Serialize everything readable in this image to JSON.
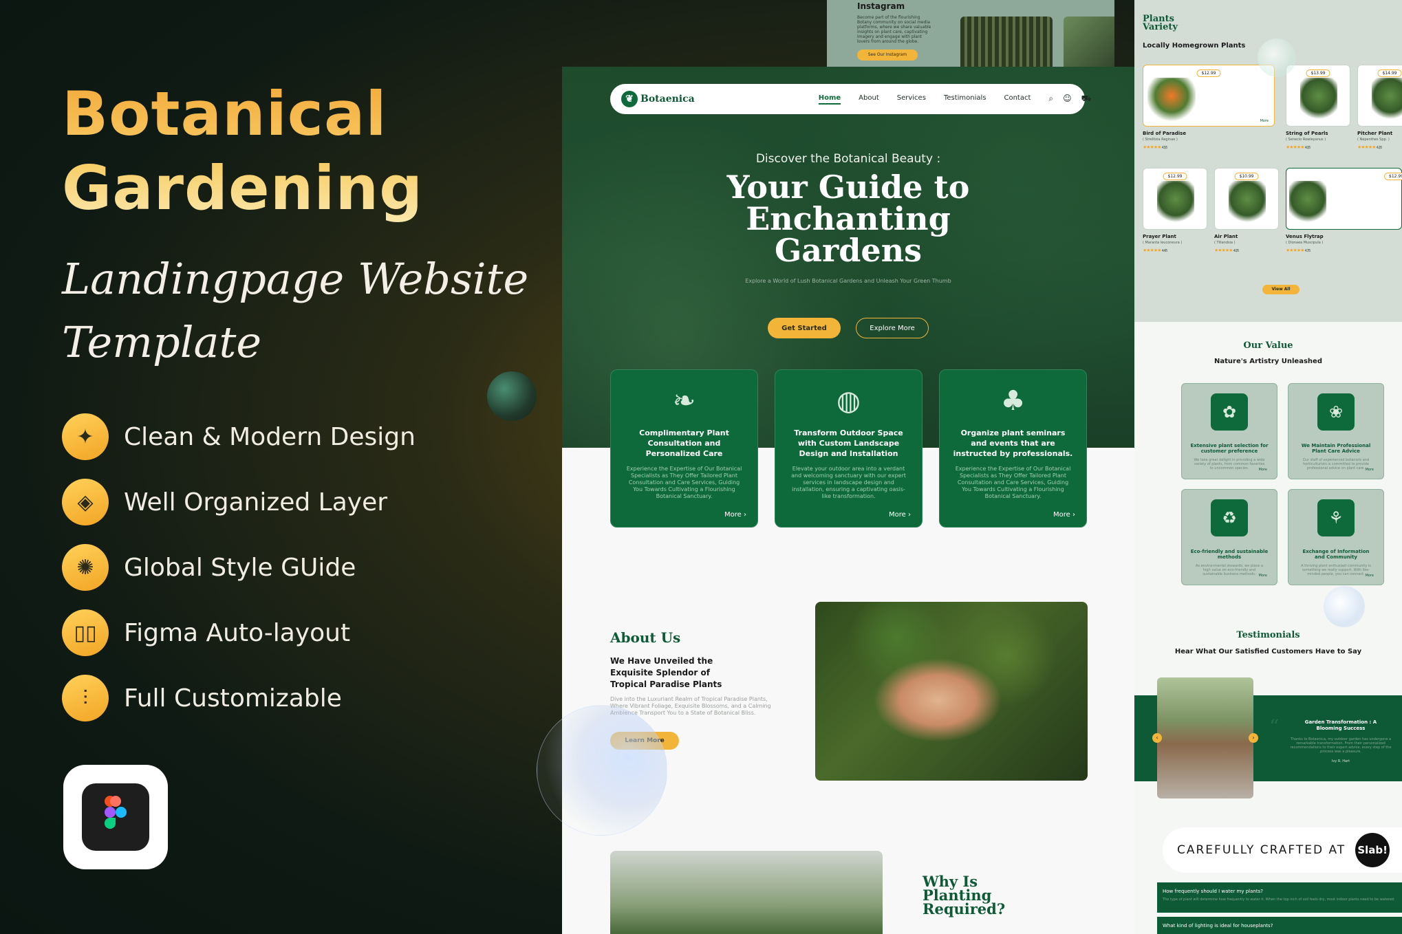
{
  "left": {
    "title_line1": "Botanical",
    "title_line2": "Gardening",
    "subtitle_line1": "Landingpage Website",
    "subtitle_line2": "Template",
    "features": [
      {
        "icon": "magic-wand-icon",
        "glyph": "✦",
        "label": "Clean & Modern Design"
      },
      {
        "icon": "layers-icon",
        "glyph": "◈",
        "label": "Well Organized Layer"
      },
      {
        "icon": "palette-icon",
        "glyph": "✺",
        "label": "Global Style GUide"
      },
      {
        "icon": "columns-icon",
        "glyph": "▯▯",
        "label": "Figma Auto-layout"
      },
      {
        "icon": "sliders-icon",
        "glyph": "⫶",
        "label": "Full Customizable"
      }
    ],
    "badge_icon": "figma-logo-icon"
  },
  "instagram": {
    "title": "Instagram",
    "body": "Become part of the flourishing Botany community on social media platforms, where we share valuable insights on plant care, captivating imagery and engage with plant lovers from around the globe.",
    "button": "See Our Instagram"
  },
  "site": {
    "logo": "Botaenica",
    "nav": [
      "Home",
      "About",
      "Services",
      "Testimonials",
      "Contact"
    ],
    "hero_pre": "Discover the Botanical Beauty :",
    "hero_h1_1": "Your Guide to",
    "hero_h1_2": "Enchanting",
    "hero_h1_3": "Gardens",
    "hero_sub": "Explore a World of Lush Botanical Gardens and Unleash Your Green Thumb",
    "btn_primary": "Get Started",
    "btn_secondary": "Explore More",
    "cards": [
      {
        "icon": "plant-consult-icon",
        "title": "Complimentary Plant Consultation and Personalized Care",
        "body": "Experience the Expertise of Our Botanical Specialists as They Offer Tailored Plant Consultation and Care Services, Guiding You Towards Cultivating a Flourishing Botanical Sanctuary.",
        "more": "More"
      },
      {
        "icon": "landscape-globe-icon",
        "title": "Transform Outdoor Space with Custom Landscape Design and Installation",
        "body": "Elevate your outdoor area into a verdant and welcoming sanctuary with our expert services in landscape design and installation, ensuring a captivating oasis-like transformation.",
        "more": "More"
      },
      {
        "icon": "seminar-people-icon",
        "title": "Organize plant seminars and events that are instructed by professionals.",
        "body": "Experience the Expertise of Our Botanical Specialists as They Offer Tailored Plant Consultation and Care Services, Guiding You Towards Cultivating a Flourishing Botanical Sanctuary.",
        "more": "More"
      }
    ],
    "about_h": "About Us",
    "about_h2": "We Have Unveiled the Exquisite Splendor of Tropical Paradise Plants",
    "about_p": "Dive into the Luxuriant Realm of Tropical Paradise Plants, Where Vibrant Foliage, Exquisite Blossoms, and a Calming Ambience Transport You to a State of Botanical Bliss.",
    "learn_more": "Learn More",
    "why_h": "Why Is Planting Required?"
  },
  "right": {
    "plants_h1": "Plants",
    "plants_h2": "Variety",
    "plants_sub": "Locally Homegrown Plants",
    "plants": [
      {
        "name": "Bird of Paradise",
        "sci": "( Strelitzia Reginae )",
        "rating": "4.5/5",
        "price": "$12.99"
      },
      {
        "name": "String of Pearls",
        "sci": "( Senecio Rowleyanus )",
        "rating": "4.0/5",
        "price": "$13.99"
      },
      {
        "name": "Pitcher Plant",
        "sci": "( Nepenthes Spp. )",
        "rating": "4.2/5",
        "price": "$14.99"
      },
      {
        "name": "Prayer Plant",
        "sci": "( Maranta leuconeura )",
        "rating": "4.4/5",
        "price": "$12.99"
      },
      {
        "name": "Air Plant",
        "sci": "( Tillandsia )",
        "rating": "4.0/5",
        "price": "$10.99"
      },
      {
        "name": "Venus Flytrap",
        "sci": "( Dionaea Muscipula )",
        "rating": "4.7/5",
        "price": "$12.99"
      }
    ],
    "more": "More",
    "view_all": "View All",
    "value_h": "Our Value",
    "value_sub": "Nature's Artistry Unleashed",
    "values": [
      {
        "icon": "plant-selection-icon",
        "title": "Extensive plant selection for customer preference",
        "body": "We take great delight in providing a wide variety of plants, from common favorites to uncommon species."
      },
      {
        "icon": "plant-advice-icon",
        "title": "We Maintain Professional Plant Care Advice",
        "body": "Our staff of experienced botanists and horticulturists is committed to provide professional advice on plant care."
      },
      {
        "icon": "eco-leaf-icon",
        "title": "Eco-friendly and sustainable methods",
        "body": "As environmental stewards, we place a high value on eco-friendly and sustainable business methods."
      },
      {
        "icon": "community-icon",
        "title": "Exchange of Information and Community",
        "body": "A thriving plant enthusiast community is something we really support. With like-minded people, you can connect."
      }
    ],
    "test_h": "Testimonials",
    "test_sub": "Hear What Our Satisfied Customers Have to Say",
    "test_title": "Garden Transformation : A Blooming Success",
    "test_body": "Thanks to Botaenica, my outdoor garden has undergone a remarkable transformation. From their personalized recommendations to their expert advice, every step of the process was a pleasure.",
    "test_author": "Ivy R. Hart",
    "crafted": "CAREFULLY CRAFTED AT",
    "slab": "Slab!",
    "faq1_q": "How frequently should I water my plants?",
    "faq1_a": "The type of plant will determine how frequently to water it. When the top inch of soil feels dry, most indoor plants need to be watered.",
    "faq2_q": "What kind of lighting is ideal for houseplants?"
  },
  "colors": {
    "gold": "#f2b53a",
    "brand_green": "#0f6a3b",
    "dark_green": "#0f5a36"
  }
}
